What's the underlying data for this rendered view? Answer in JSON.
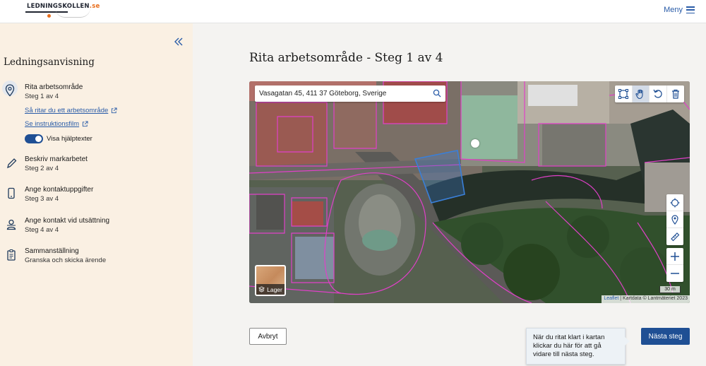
{
  "header": {
    "logo_text": "LEDNINGSKOLLEN",
    "logo_tld": ".se",
    "menu_label": "Meny"
  },
  "sidebar": {
    "title": "Ledningsanvisning",
    "steps": [
      {
        "title": "Rita arbetsområde",
        "sub": "Steg 1 av 4",
        "icon": "map-pin-icon",
        "active": true
      },
      {
        "title": "Beskriv markarbetet",
        "sub": "Steg 2 av 4",
        "icon": "pencil-icon"
      },
      {
        "title": "Ange kontaktuppgifter",
        "sub": "Steg 3 av 4",
        "icon": "phone-icon"
      },
      {
        "title": "Ange kontakt vid utsättning",
        "sub": "Steg 4 av 4",
        "icon": "person-icon"
      },
      {
        "title": "Sammanställning",
        "sub": "Granska och skicka ärende",
        "icon": "clipboard-icon"
      }
    ],
    "links": [
      {
        "label": "Så ritar du ett arbetsområde"
      },
      {
        "label": "Se instruktionsfilm"
      }
    ],
    "toggle_label": "Visa hjälptexter",
    "toggle_on": true
  },
  "main": {
    "title": "Rita arbetsområde - Steg 1 av 4",
    "search_value": "Vasagatan 45, 411 37 Göteborg, Sverige",
    "layer_label": "Lager",
    "scale_label": "30 m",
    "attribution_link": "Leaflet",
    "attribution_text": " | Kartdata © Lantmäteriet 2023",
    "cancel_label": "Avbryt",
    "next_label": "Nästa steg",
    "tooltip_text": "När du ritat klart i kartan klickar du här för att gå vidare till nästa steg."
  },
  "colors": {
    "primary": "#1f4f94",
    "link": "#2a5ca8",
    "sidebar_bg": "#faf0e3",
    "accent_orange": "#e86e1c",
    "property_line": "#e040c8",
    "drawn_area": "#3a7fd8"
  }
}
